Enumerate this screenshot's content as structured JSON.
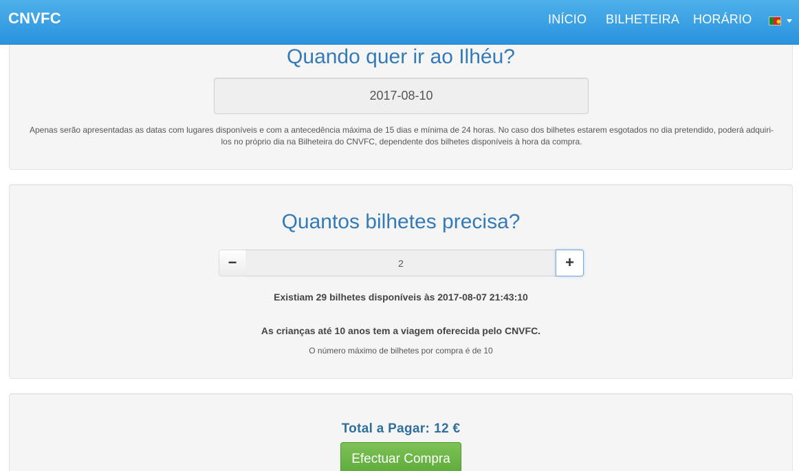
{
  "navbar": {
    "brand": "CNVFC",
    "items": [
      {
        "label": "INÍCIO"
      },
      {
        "label": "BILHETEIRA"
      },
      {
        "label": "HORÁRIO"
      }
    ],
    "language_flag": "portugal-flag-icon",
    "accent_color": "#2a93dd"
  },
  "date_section": {
    "title": "Quando quer ir ao Ilhéu?",
    "date_value": "2017-08-10",
    "note": "Apenas serão apresentadas as datas com lugares disponíveis e com a antecedência máxima de 15 dias e mínima de 24 horas. No caso dos bilhetes estarem esgotados no dia pretendido, poderá adquiri-los no próprio dia na Bilheteira do CNVFC, dependente dos bilhetes disponíveis à hora da compra."
  },
  "tickets_section": {
    "title": "Quantos bilhetes precisa?",
    "minus_label": "−",
    "quantity": "2",
    "plus_label": "+",
    "availability": "Existiam 29 bilhetes disponíveis às 2017-08-07 21:43:10",
    "children_note": "As crianças até 10 anos tem a viagem oferecida pelo CNVFC.",
    "max_note": "O número máximo de bilhetes por compra é de 10"
  },
  "total_section": {
    "label": "Total a Pagar:",
    "amount": "12 €",
    "buy_label": "Efectuar Compra",
    "buy_color": "#6cb647"
  }
}
